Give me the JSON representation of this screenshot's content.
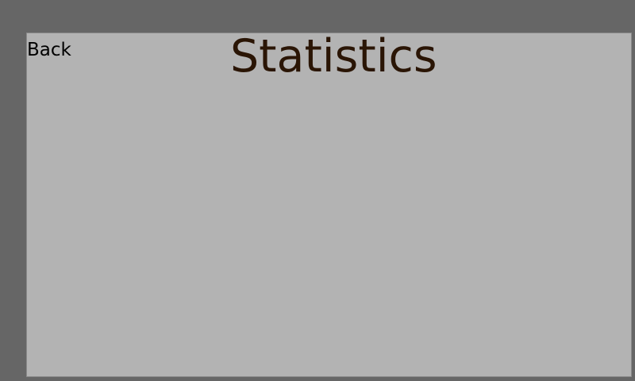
{
  "header": {
    "back_label": "Back",
    "title": "Statistics"
  },
  "colors": {
    "background": "#666666",
    "panel": "#b3b3b3",
    "title": "#2a1505",
    "back_text": "#000000"
  }
}
